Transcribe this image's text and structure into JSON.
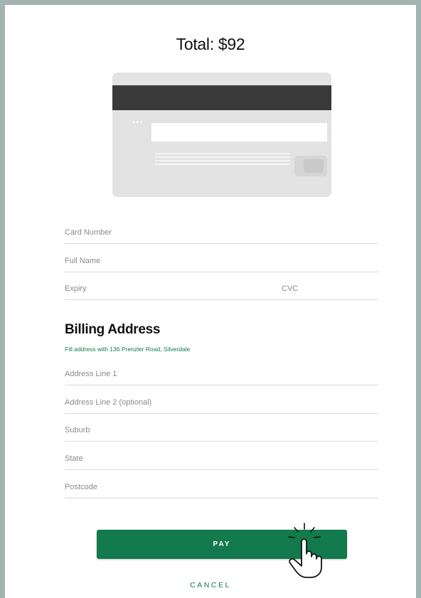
{
  "header": {
    "total": "Total: $92"
  },
  "card_form": {
    "card_number_placeholder": "Card Number",
    "full_name_placeholder": "Full Name",
    "expiry_placeholder": "Expiry",
    "cvc_placeholder": "CVC"
  },
  "billing": {
    "title": "Billing Address",
    "fill_link": "Fill address with 136 Prenzler Road, Silverdale",
    "address1_placeholder": "Address Line 1",
    "address2_placeholder": "Address Line 2 (optional)",
    "suburb_placeholder": "Suburb",
    "state_placeholder": "State",
    "postcode_placeholder": "Postcode"
  },
  "actions": {
    "pay_label": "PAY",
    "cancel_label": "CANCEL"
  },
  "colors": {
    "accent": "#127a4c",
    "background": "#a3b5b0"
  },
  "icons": {
    "card": "credit-card-back-icon",
    "cursor": "hand-pointer-icon"
  }
}
